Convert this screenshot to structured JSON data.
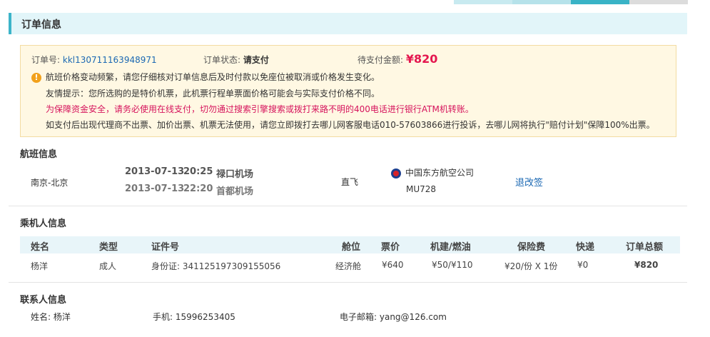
{
  "section_title": "订单信息",
  "order": {
    "number_label": "订单号:",
    "number_value": "kkl130711163948971",
    "status_label": "订单状态:",
    "status_value": "请支付",
    "pay_label": "待支付金额:",
    "pay_value": "¥820"
  },
  "notices": {
    "warning": "航班价格变动频繁，请您仔细核对订单信息后及时付款以免座位被取消或价格发生变化。",
    "tip": "友情提示：您所选购的是特价机票，此机票行程单票面价格可能会与实际支付价格不同。",
    "security": "为保障资金安全，请务必使用在线支付，切勿通过搜索引擎搜索或拨打来路不明的400电话进行银行ATM机转账。",
    "complaint": "如支付后出现代理商不出票、加价出票、机票无法使用，请您立即拨打去哪儿网客服电话010-57603866进行投诉，去哪儿网将执行\"赔付计划\"保障100%出票。"
  },
  "flight": {
    "title": "航班信息",
    "route": "南京-北京",
    "dep_date": "2013-07-13",
    "dep_time": "20:25",
    "dep_airport": "禄口机场",
    "arr_date": "2013-07-13",
    "arr_time": "22:20",
    "arr_airport": "首都机场",
    "type": "直飞",
    "airline": "中国东方航空公司",
    "flight_no": "MU728",
    "refund_link": "退改签"
  },
  "passengers": {
    "title": "乘机人信息",
    "headers": [
      "姓名",
      "类型",
      "证件号",
      "舱位",
      "票价",
      "机建/燃油",
      "保险费",
      "快递",
      "订单总额"
    ],
    "rows": [
      {
        "name": "杨洋",
        "type": "成人",
        "id": "身份证: 341125197309155056",
        "cabin": "经济舱",
        "price": "¥640",
        "tax": "¥50/¥110",
        "insurance": "¥20/份 X 1份",
        "express": "¥0",
        "total": "¥820"
      }
    ]
  },
  "contact": {
    "title": "联系人信息",
    "name_label": "姓名:",
    "name_value": "杨洋",
    "phone_label": "手机:",
    "phone_value": "15996253405",
    "email_label": "电子邮箱:",
    "email_value": "yang@126.com"
  },
  "colors": {
    "accent": "#3cb4c9",
    "price_red": "#e4164e",
    "link_blue": "#1b68b3",
    "notice_bg": "#fff8e3"
  }
}
